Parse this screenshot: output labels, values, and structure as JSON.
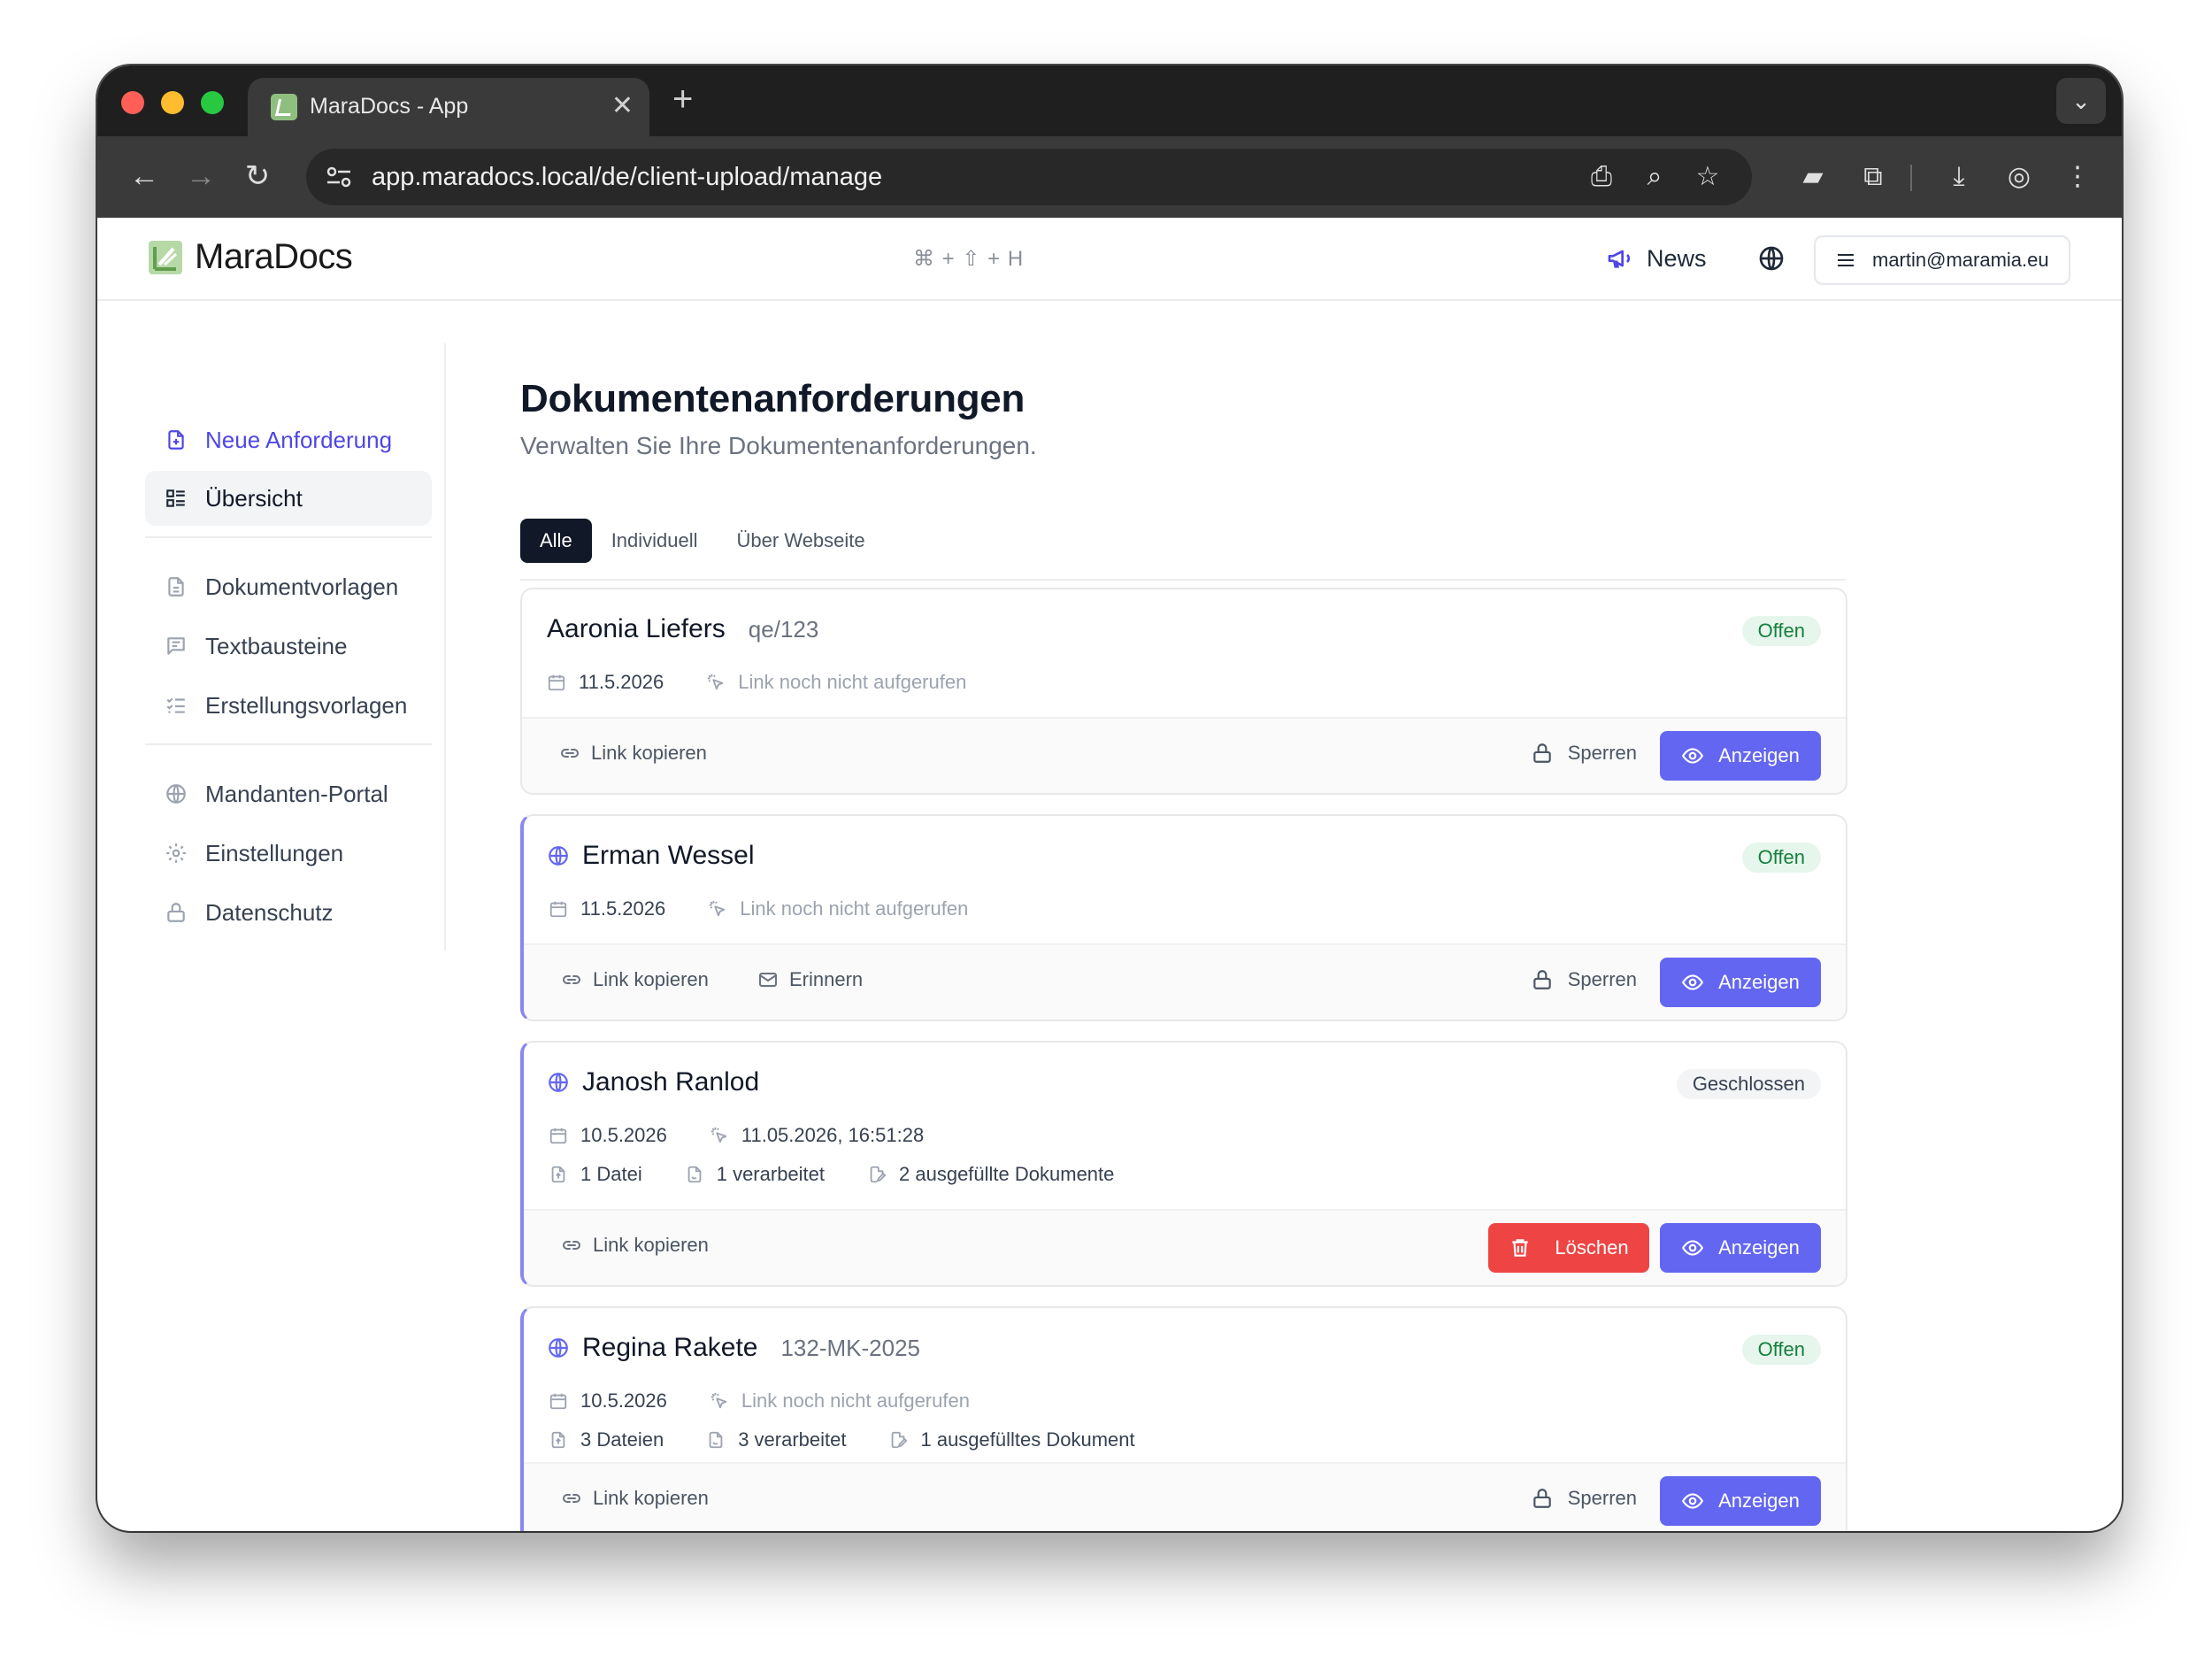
{
  "browser": {
    "tab_title": "MaraDocs - App",
    "url": "app.maradocs.local/de/client-upload/manage"
  },
  "header": {
    "brand_part1": "Mara",
    "brand_part2": "Docs",
    "shortcut": "⌘ + ⇧ + H",
    "news_label": "News",
    "user_email": "martin@maramia.eu"
  },
  "sidebar": {
    "items": [
      {
        "label": "Neue Anforderung",
        "icon": "file-plus-icon"
      },
      {
        "label": "Übersicht",
        "icon": "list-icon"
      },
      {
        "label": "Dokumentvorlagen",
        "icon": "file-text-icon"
      },
      {
        "label": "Textbausteine",
        "icon": "message-square-icon"
      },
      {
        "label": "Erstellungsvorlagen",
        "icon": "list-checks-icon"
      },
      {
        "label": "Mandanten-Portal",
        "icon": "globe-icon"
      },
      {
        "label": "Einstellungen",
        "icon": "gear-icon"
      },
      {
        "label": "Datenschutz",
        "icon": "lock-icon"
      }
    ]
  },
  "main": {
    "title": "Dokumentenanforderungen",
    "subtitle": "Verwalten Sie Ihre Dokumentenanforderungen.",
    "tabs": [
      "Alle",
      "Individuell",
      "Über Webseite"
    ],
    "cards": [
      {
        "name": "Aaronia Liefers",
        "ref": "qe/123",
        "status": "Offen",
        "date": "11.5.2026",
        "link_status": "Link noch nicht aufgerufen",
        "copy_label": "Link kopieren",
        "lock_label": "Sperren",
        "view_label": "Anzeigen"
      },
      {
        "name": "Erman Wessel",
        "status": "Offen",
        "date": "11.5.2026",
        "link_status": "Link noch nicht aufgerufen",
        "copy_label": "Link kopieren",
        "remind_label": "Erinnern",
        "lock_label": "Sperren",
        "view_label": "Anzeigen"
      },
      {
        "name": "Janosh Ranlod",
        "status": "Geschlossen",
        "date": "10.5.2026",
        "link_status": "11.05.2026, 16:51:28",
        "files": "1 Datei",
        "processed": "1 verarbeitet",
        "filled": "2 ausgefüllte Dokumente",
        "copy_label": "Link kopieren",
        "delete_label": "Löschen",
        "view_label": "Anzeigen"
      },
      {
        "name": "Regina Rakete",
        "ref": "132-MK-2025",
        "status": "Offen",
        "date": "10.5.2026",
        "link_status": "Link noch nicht aufgerufen",
        "files": "3 Dateien",
        "processed": "3 verarbeitet",
        "filled": "1 ausgefülltes Dokument",
        "copy_label": "Link kopieren",
        "lock_label": "Sperren",
        "view_label": "Anzeigen"
      }
    ]
  },
  "colors": {
    "accent": "#6366f1",
    "danger": "#ef4444",
    "status_open": "#15803d",
    "brand_green": "#8fbf7f"
  }
}
